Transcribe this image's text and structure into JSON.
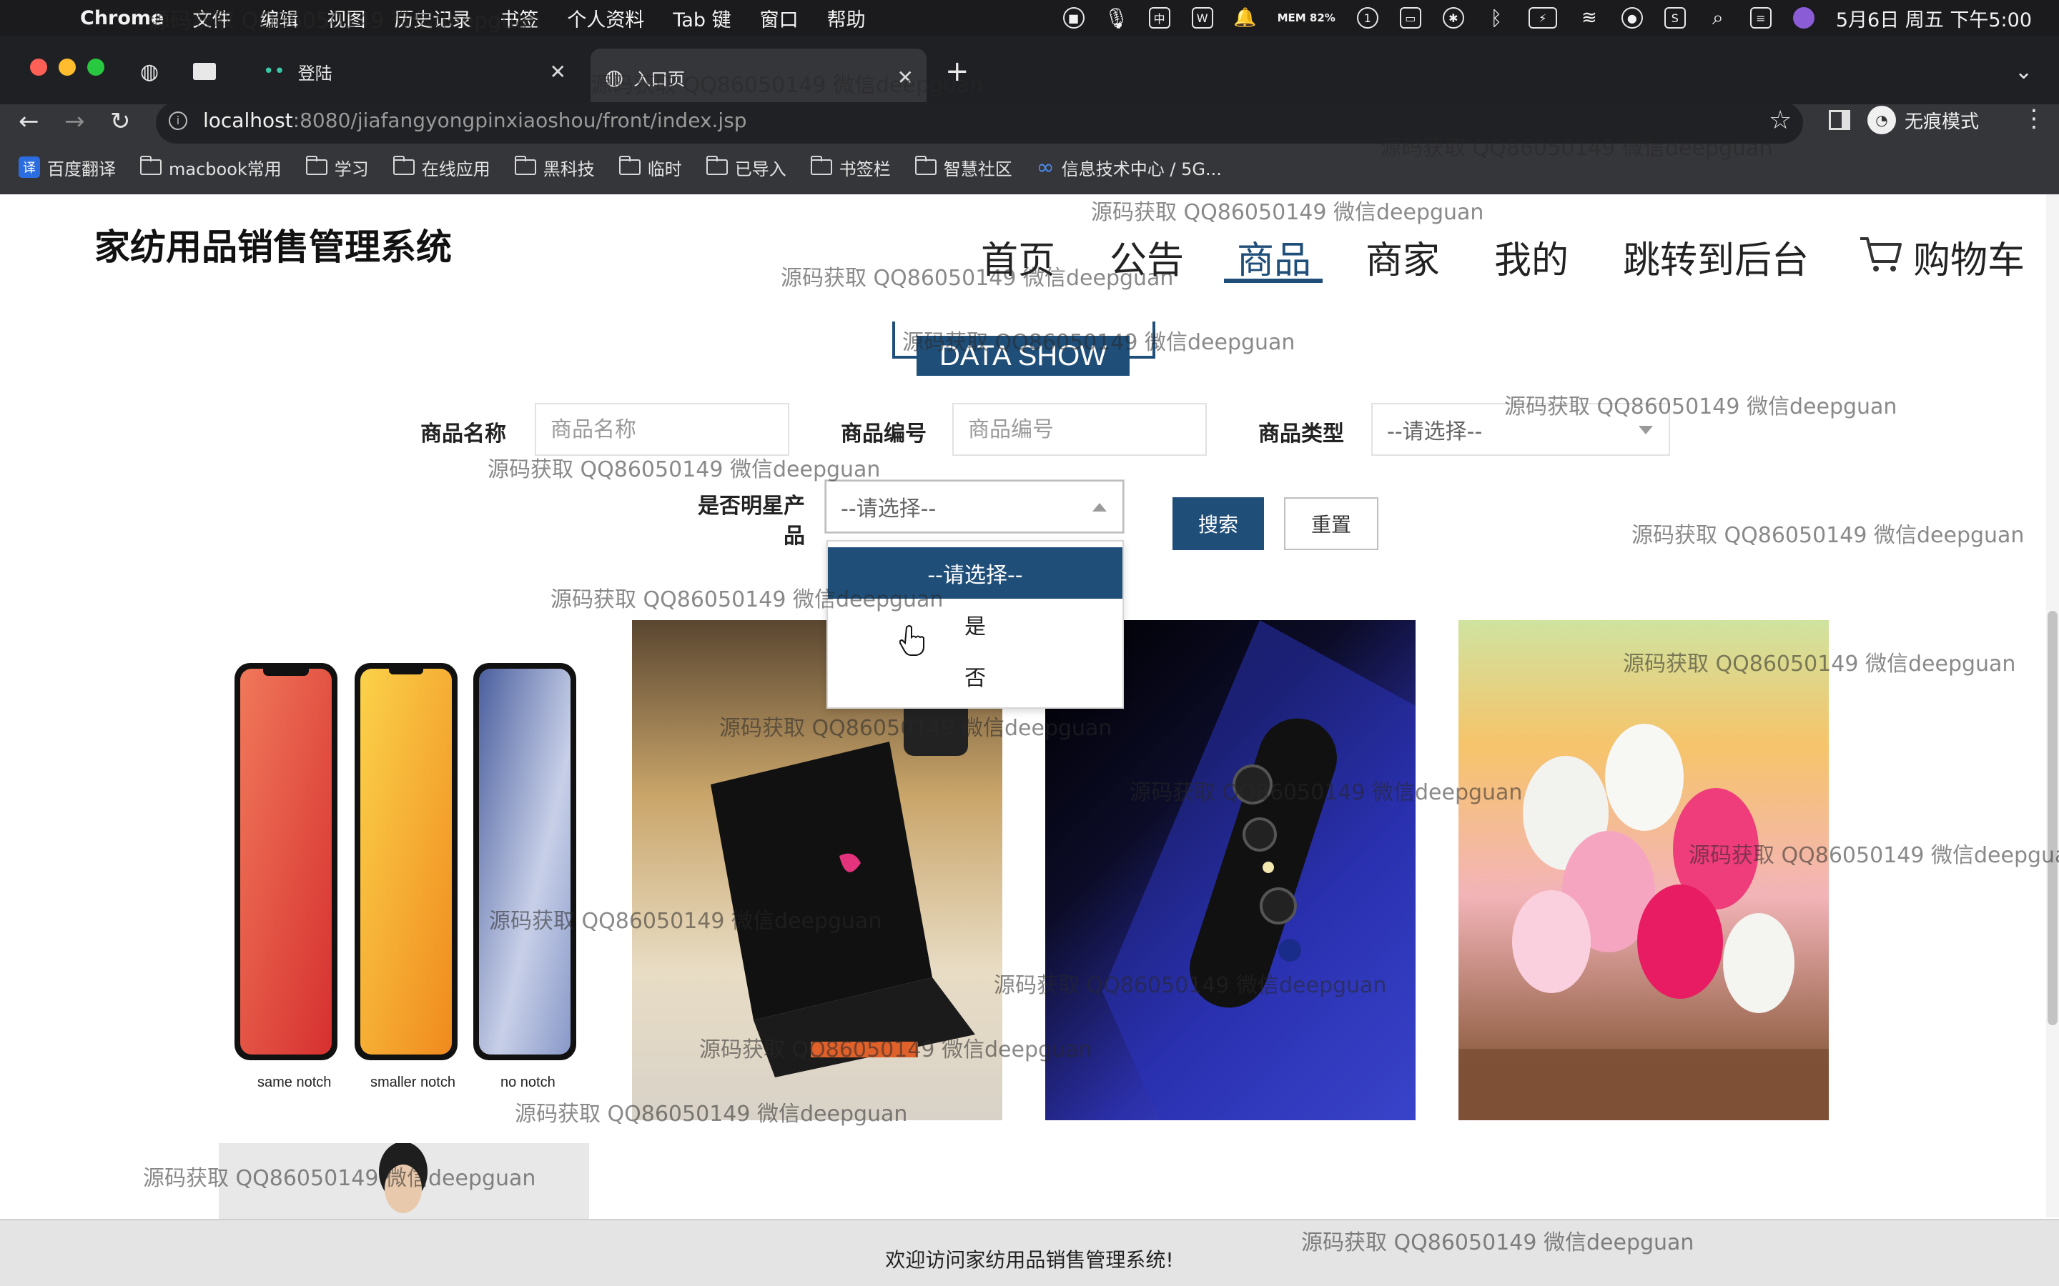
{
  "menubar": {
    "app_name": "Chrome",
    "menus": [
      "文件",
      "编辑",
      "视图",
      "历史记录",
      "书签",
      "个人资料",
      "Tab 键",
      "窗口",
      "帮助"
    ],
    "memory": "MEM 82%",
    "datetime": "5月6日 周五 下午5:00"
  },
  "browser": {
    "tabs": [
      {
        "label": ""
      },
      {
        "label": "登陆"
      },
      {
        "label": "入口页"
      }
    ],
    "url_host": "localhost",
    "url_path": ":8080/jiafangyongpinxiaoshou/front/index.jsp",
    "incognito_label": "无痕模式",
    "bookmarks": [
      "百度翻译",
      "macbook常用",
      "学习",
      "在线应用",
      "黑科技",
      "临时",
      "已导入",
      "书签栏",
      "智慧社区",
      "信息技术中心 / 5G..."
    ]
  },
  "site": {
    "title": "家纺用品销售管理系统",
    "nav": [
      "首页",
      "公告",
      "商品",
      "商家",
      "我的",
      "跳转到后台",
      "购物车"
    ],
    "active_nav": "商品",
    "section_title": "DATA SHOW"
  },
  "search_form": {
    "name_label": "商品名称",
    "name_placeholder": "商品名称",
    "code_label": "商品编号",
    "code_placeholder": "商品编号",
    "type_label": "商品类型",
    "type_value": "--请选择--",
    "star_label_line1": "是否明星产",
    "star_label_line2": "品",
    "star_value": "--请选择--",
    "search_button": "搜索",
    "reset_button": "重置",
    "star_options": [
      "--请选择--",
      "是",
      "否"
    ]
  },
  "products": {
    "phone_captions": [
      "same notch",
      "smaller notch",
      "no notch"
    ]
  },
  "footer": {
    "text": "欢迎访问家纺用品销售管理系统!"
  },
  "watermark": "源码获取 QQ86050149 微信deepguan",
  "colors": {
    "accent": "#1f4e79",
    "menubar": "#1b1b1d",
    "toolbar": "#35363a"
  }
}
